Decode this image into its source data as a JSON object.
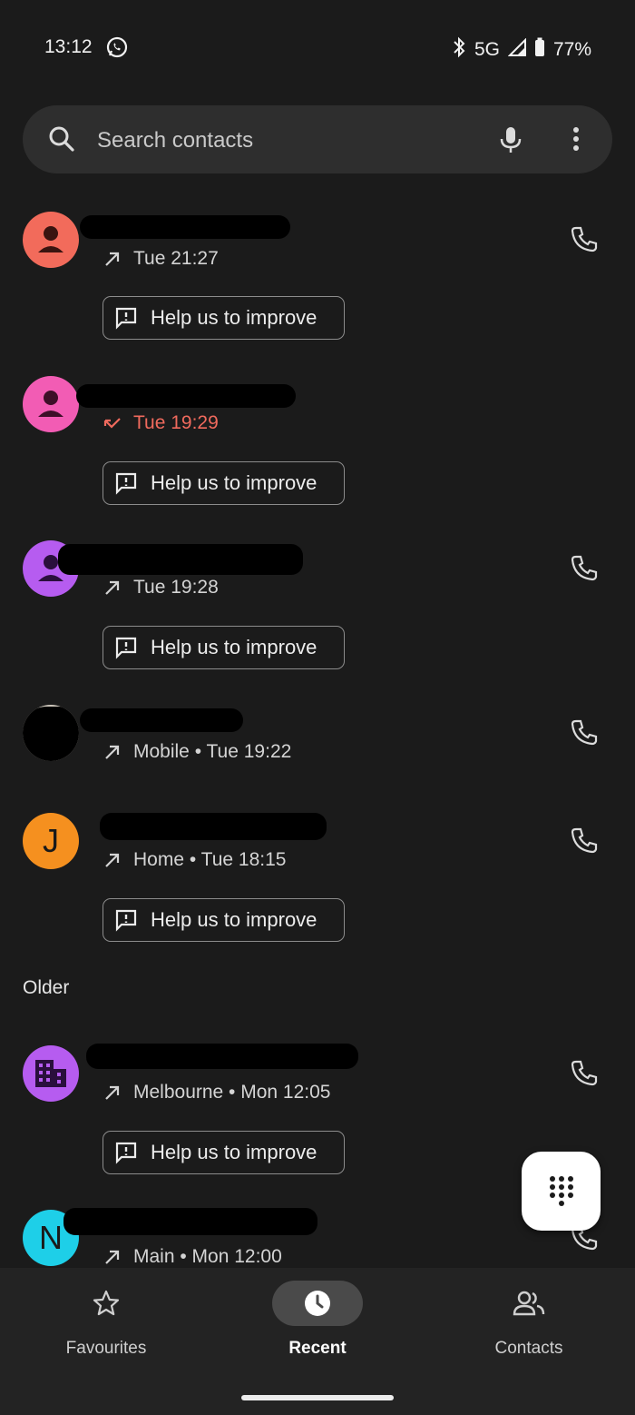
{
  "status_bar": {
    "time": "13:12",
    "network": "5G",
    "battery": "77%",
    "icons": [
      "whatsapp-icon",
      "bluetooth-icon",
      "signal-icon",
      "battery-icon"
    ]
  },
  "search": {
    "placeholder": "Search contacts",
    "icons": [
      "search-icon",
      "mic-icon",
      "more-vert-icon"
    ]
  },
  "calls": [
    {
      "direction": "outgoing",
      "detail": "Tue 21:27",
      "avatar": "person",
      "avatar_color": "#f26b5b",
      "has_call_button": true,
      "help_chip": "Help us to improve"
    },
    {
      "direction": "missed",
      "detail": "Tue 19:29",
      "avatar": "person",
      "avatar_color": "#f25cb4",
      "has_call_button": false,
      "help_chip": "Help us to improve"
    },
    {
      "direction": "outgoing",
      "detail": "Tue 19:28",
      "avatar": "person",
      "avatar_color": "#b65cf0",
      "has_call_button": true,
      "help_chip": "Help us to improve"
    },
    {
      "direction": "outgoing",
      "detail": "Mobile • Tue 19:22",
      "avatar": "photo",
      "avatar_color": "#cfc8bd",
      "has_call_button": true,
      "help_chip": ""
    },
    {
      "direction": "outgoing",
      "detail": "Home • Tue 18:15",
      "avatar": "J",
      "avatar_color": "#f5901f",
      "has_call_button": true,
      "help_chip": "Help us to improve"
    },
    {
      "direction": "outgoing",
      "detail": "Melbourne • Mon 12:05",
      "avatar": "business",
      "avatar_color": "#b65cf0",
      "has_call_button": true,
      "help_chip": "Help us to improve"
    },
    {
      "direction": "outgoing",
      "detail": "Main • Mon 12:00",
      "avatar": "N",
      "avatar_color": "#1ecfe8",
      "has_call_button": true,
      "help_chip": ""
    }
  ],
  "section_older": "Older",
  "nav": {
    "items": [
      {
        "label": "Favourites",
        "icon": "star-icon",
        "active": false
      },
      {
        "label": "Recent",
        "icon": "clock-icon",
        "active": true
      },
      {
        "label": "Contacts",
        "icon": "people-icon",
        "active": false
      }
    ]
  },
  "colors": {
    "background": "#1b1b1b",
    "missed_call": "#f06a5d",
    "fab": "#ffffff"
  }
}
